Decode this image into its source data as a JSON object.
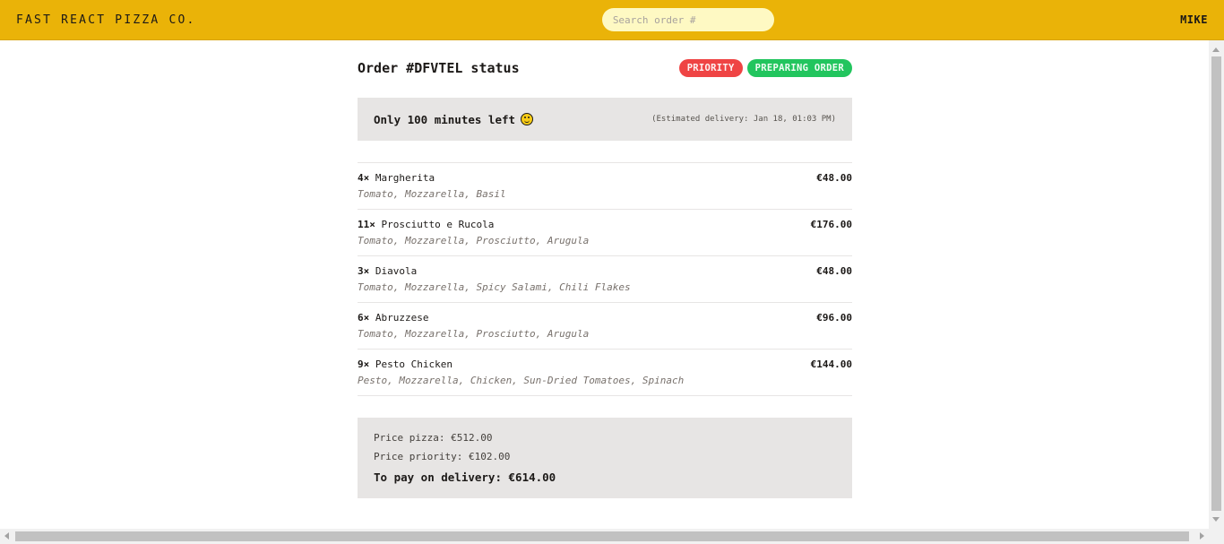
{
  "header": {
    "brand": "FAST REACT PIZZA CO.",
    "search_placeholder": "Search order #",
    "user": "MIKE"
  },
  "order": {
    "title": "Order #DFVTEL status",
    "badges": {
      "priority": "PRIORITY",
      "status": "PREPARING ORDER"
    },
    "eta": {
      "left_text": "Only 100 minutes left",
      "emoji": "smiley-face-icon",
      "right_text": "(Estimated delivery: Jan 18, 01:03 PM)"
    },
    "items": [
      {
        "qty": "4×",
        "name": "Margherita",
        "price": "€48.00",
        "ingredients": "Tomato, Mozzarella, Basil"
      },
      {
        "qty": "11×",
        "name": "Prosciutto e Rucola",
        "price": "€176.00",
        "ingredients": "Tomato, Mozzarella, Prosciutto, Arugula"
      },
      {
        "qty": "3×",
        "name": "Diavola",
        "price": "€48.00",
        "ingredients": "Tomato, Mozzarella, Spicy Salami, Chili Flakes"
      },
      {
        "qty": "6×",
        "name": "Abruzzese",
        "price": "€96.00",
        "ingredients": "Tomato, Mozzarella, Prosciutto, Arugula"
      },
      {
        "qty": "9×",
        "name": "Pesto Chicken",
        "price": "€144.00",
        "ingredients": "Pesto, Mozzarella, Chicken, Sun-Dried Tomatoes, Spinach"
      }
    ],
    "summary": {
      "price_pizza": "Price pizza: €512.00",
      "price_priority": "Price priority: €102.00",
      "total": "To pay on delivery: €614.00"
    }
  },
  "colors": {
    "header_bg": "#eab308",
    "priority_badge": "#ef4444",
    "status_badge": "#22c55e",
    "panel_bg": "#e7e5e4"
  }
}
